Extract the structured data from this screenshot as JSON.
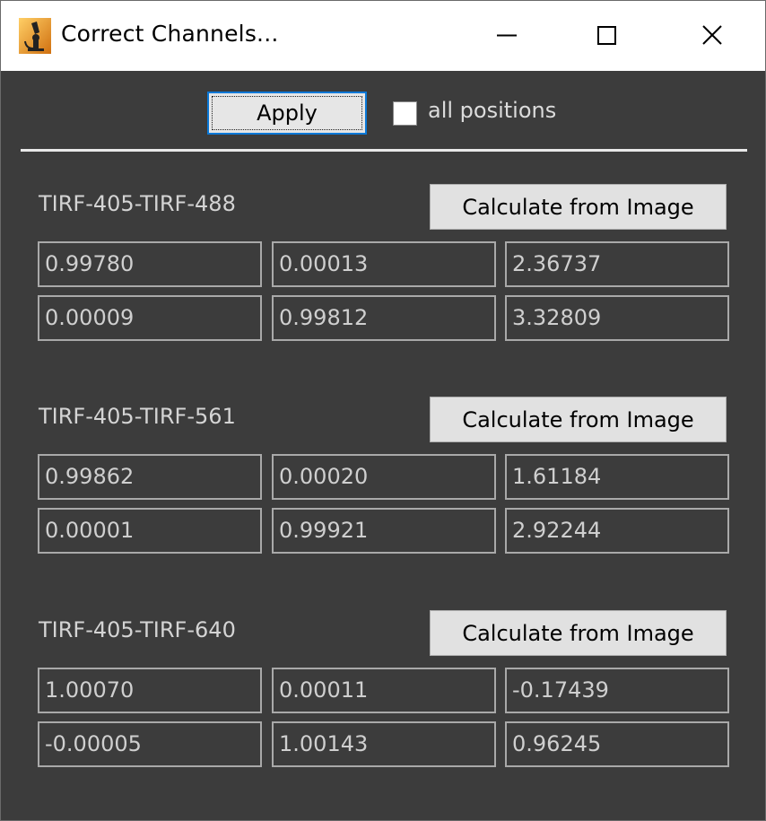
{
  "window": {
    "title": "Correct Channels..."
  },
  "toolbar": {
    "apply_label": "Apply",
    "all_positions_label": "all positions",
    "all_positions_checked": false
  },
  "groups": [
    {
      "label": "TIRF-405-TIRF-488",
      "calc_label": "Calculate from Image",
      "rows": [
        [
          "0.99780",
          "0.00013",
          "2.36737"
        ],
        [
          "0.00009",
          "0.99812",
          "3.32809"
        ]
      ]
    },
    {
      "label": "TIRF-405-TIRF-561",
      "calc_label": "Calculate from Image",
      "rows": [
        [
          "0.99862",
          "0.00020",
          "1.61184"
        ],
        [
          "0.00001",
          "0.99921",
          "2.92244"
        ]
      ]
    },
    {
      "label": "TIRF-405-TIRF-640",
      "calc_label": "Calculate from Image",
      "rows": [
        [
          "1.00070",
          "0.00011",
          "-0.17439"
        ],
        [
          "-0.00005",
          "1.00143",
          "0.96245"
        ]
      ]
    }
  ],
  "colors": {
    "background": "#3c3c3c",
    "focus_accent": "#0a78d7",
    "field_border": "#a9a9a9"
  }
}
